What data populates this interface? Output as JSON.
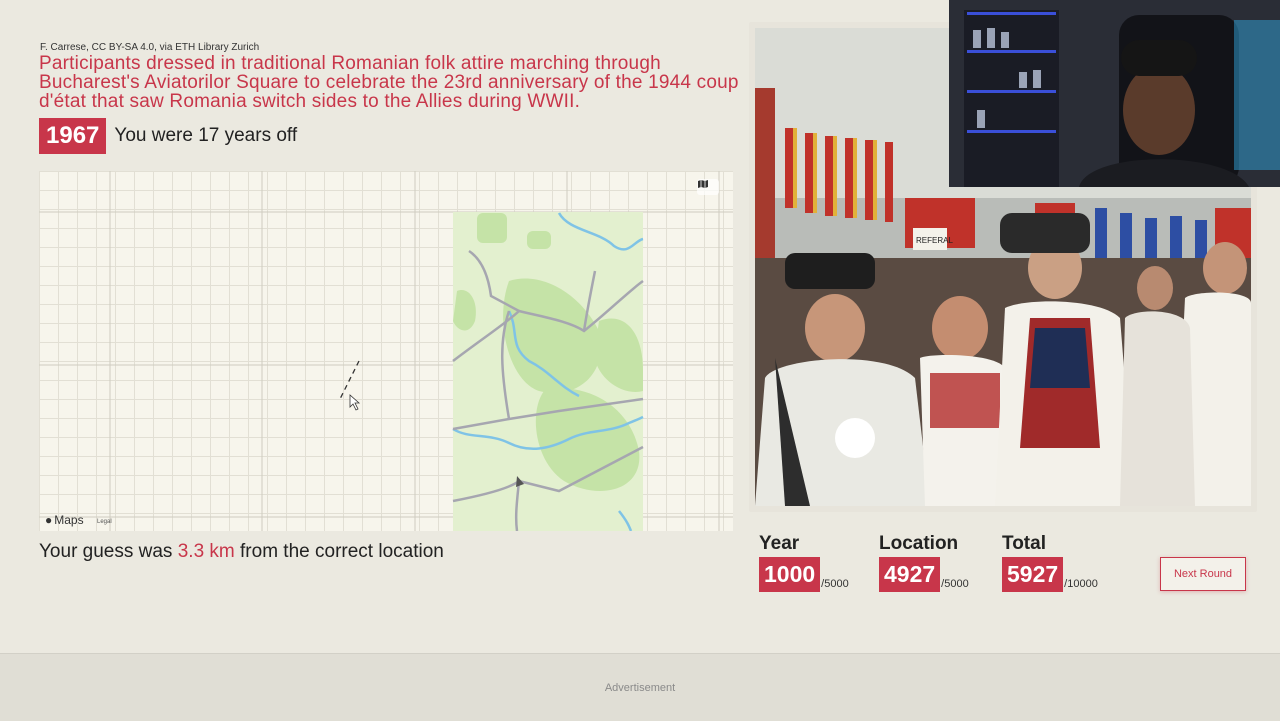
{
  "photo_credit": "F. Carrese, CC BY-SA 4.0, via ETH Library Zurich",
  "caption": "Participants dressed in traditional Romanian folk attire marching through Bucharest's Aviatorilor Square to celebrate the 23rd anniversary of the 1944 coup d'état that saw Romania switch sides to the Allies during WWII.",
  "answer": {
    "year": "1967",
    "year_off_text": "You were 17 years off"
  },
  "map": {
    "provider_label": "Maps",
    "legal_label": "Legal",
    "layers_icon": "map-layers-icon"
  },
  "distance": {
    "prefix": "Your guess was ",
    "value": "3.3 km",
    "suffix": " from the correct location"
  },
  "photo_sign_text": "REFERAL",
  "scores": {
    "year": {
      "label": "Year",
      "value": "1000",
      "max": "/5000"
    },
    "location": {
      "label": "Location",
      "value": "4927",
      "max": "/5000"
    },
    "total": {
      "label": "Total",
      "value": "5927",
      "max": "/10000"
    }
  },
  "next_button": "Next Round",
  "ad_label": "Advertisement",
  "colors": {
    "accent": "#c8364a",
    "background": "#ebe9e0"
  }
}
